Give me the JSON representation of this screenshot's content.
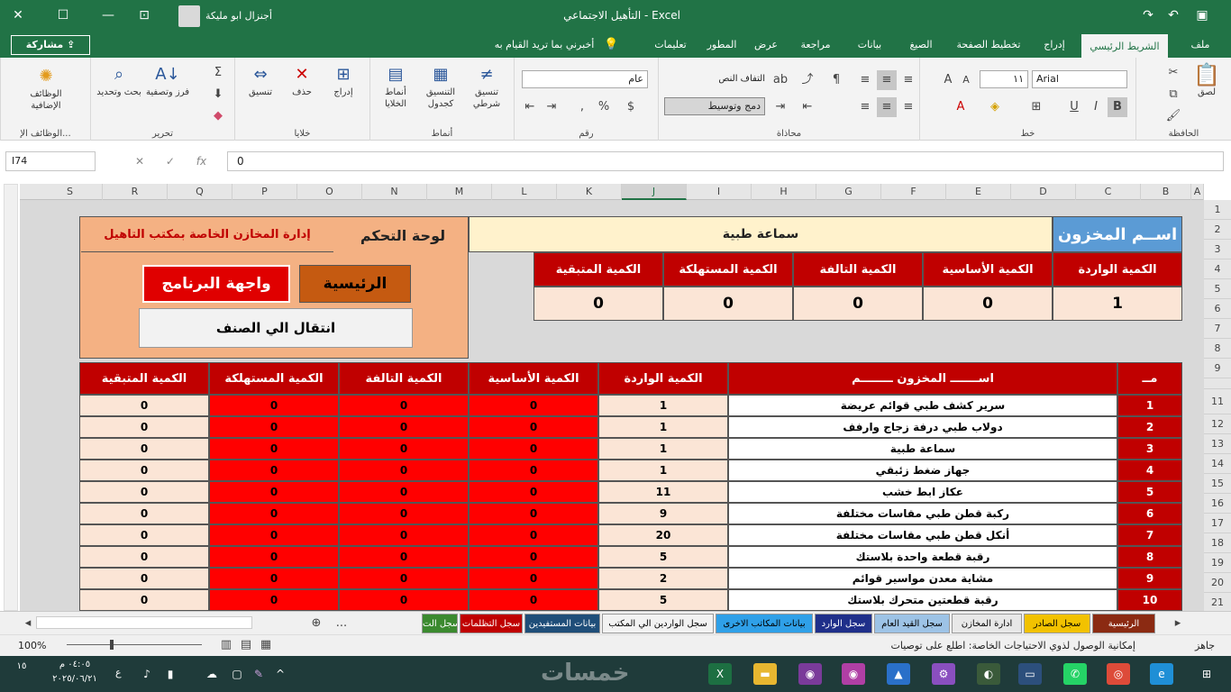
{
  "window": {
    "title": "التأهيل الاجتماعي  -  Excel",
    "user": "أجنزال ابو مليكة"
  },
  "titlebar_icons": {
    "save": "save-icon",
    "undo": "undo-icon",
    "redo": "redo-icon",
    "restore": "restore-icon",
    "minimize": "minimize-icon",
    "close": "close-icon"
  },
  "menu": {
    "share": "مشاركة",
    "tellme": "أخبرني بما تريد القيام به",
    "tabs": [
      "ملف",
      "الشريط الرئيسي",
      "إدراج",
      "تخطيط الصفحة",
      "الصيغ",
      "بيانات",
      "مراجعة",
      "عرض",
      "المطور",
      "تعليمات"
    ]
  },
  "ribbon": {
    "clipboard": {
      "label": "الحافظة",
      "paste": "لصق"
    },
    "font": {
      "label": "خط",
      "name": "Arial",
      "size": "١١",
      "bold": "B"
    },
    "alignment": {
      "label": "محاذاة",
      "wrap": "التفاف النص",
      "merge": "دمج وتوسيط"
    },
    "number": {
      "label": "رقم",
      "format": "عام"
    },
    "styles": {
      "label": "أنماط",
      "conditional": "تنسيق شرطي",
      "table": "التنسيق كجدول",
      "cell": "أنماط الخلايا"
    },
    "cells": {
      "label": "خلايا",
      "insert": "إدراج",
      "delete": "حذف",
      "format": "تنسيق"
    },
    "editing": {
      "label": "تحرير",
      "sort": "فرز وتصفية",
      "find": "بحث وتحديد"
    },
    "addins": {
      "label": "الوظائف الإ...",
      "name": "الوظائف الإضافية"
    }
  },
  "formula": {
    "namebox": "I74",
    "fx": "fx",
    "value": "0"
  },
  "columns": [
    "A",
    "B",
    "C",
    "D",
    "E",
    "F",
    "G",
    "H",
    "I",
    "J",
    "K",
    "L",
    "M",
    "N",
    "O",
    "P",
    "Q",
    "R",
    "S"
  ],
  "rows": [
    "1",
    "2",
    "3",
    "4",
    "5",
    "6",
    "7",
    "8",
    "9",
    "",
    "11",
    "12",
    "13",
    "14",
    "15",
    "16",
    "17",
    "18",
    "19",
    "20",
    "21"
  ],
  "top": {
    "store_label": "اســم المخزون",
    "store_value": "سماعة طبية",
    "control_title": "لوحة التحكم",
    "admin_title": "إدارة المخازن الخاصة بمكتب التاهيل",
    "btn_main": "الرئيسية",
    "btn_ui": "واجهة البرنامج",
    "btn_goto": "انتقال الي الصنف",
    "headers": [
      "الكمية الواردة",
      "الكمية الأساسية",
      "الكمية التالفة",
      "الكمية المستهلكة",
      "الكمية المتبقية"
    ],
    "values": [
      "1",
      "0",
      "0",
      "0",
      "0"
    ]
  },
  "table": {
    "headers": [
      "مــ",
      "اســـــــ المخزون ــــــــم",
      "الكمية الواردة",
      "الكمية الأساسية",
      "الكمية التالفة",
      "الكمية المستهلكة",
      "الكمية المتبقية"
    ],
    "rows": [
      [
        "1",
        "سرير كشف طبي قوائم عريضة",
        "1",
        "0",
        "0",
        "0",
        "0"
      ],
      [
        "2",
        "دولاب طبي درفة زجاج وارفف",
        "1",
        "0",
        "0",
        "0",
        "0"
      ],
      [
        "3",
        "سماعة طبية",
        "1",
        "0",
        "0",
        "0",
        "0"
      ],
      [
        "4",
        "جهاز ضغط زئبقي",
        "1",
        "0",
        "0",
        "0",
        "0"
      ],
      [
        "5",
        "عكاز ابط خشب",
        "11",
        "0",
        "0",
        "0",
        "0"
      ],
      [
        "6",
        "ركبة قطن طبي مقاسات مختلفة",
        "9",
        "0",
        "0",
        "0",
        "0"
      ],
      [
        "7",
        "أنكل قطن طبي مقاسات مختلفة",
        "20",
        "0",
        "0",
        "0",
        "0"
      ],
      [
        "8",
        "رقبة قطعة واحدة بلاستك",
        "5",
        "0",
        "0",
        "0",
        "0"
      ],
      [
        "9",
        "مشاية معدن مواسير قوائم",
        "2",
        "0",
        "0",
        "0",
        "0"
      ],
      [
        "10",
        "رقبة قطعتين متحرك بلاستك",
        "5",
        "0",
        "0",
        "0",
        "0"
      ]
    ]
  },
  "sheets": [
    "الرئيسية",
    "سجل الصادر",
    "ادارة المخازن",
    "سجل القيد العام",
    "سجل الوارد",
    "بيانات المكاتب الاخرى",
    "سجل الواردين الي المكتب",
    "بيانات المستفيدين",
    "سجل التظلمات",
    "سجل الت"
  ],
  "sheet_colors": [
    "#8b2a12",
    "#f2c200",
    "#e8e8e8",
    "#9dc3e6",
    "#1f2f8a",
    "#2fa0e8",
    "#f2f2f2",
    "#1f4e79",
    "#c00000",
    "#3b8a2f"
  ],
  "sheet_more": "...",
  "status": {
    "ready": "جاهز",
    "accessibility": "إمكانية الوصول لذوي الاحتياجات الخاصة: اطلع على توصيات",
    "zoom": "100%"
  },
  "taskbar": {
    "time": "٠٤:٠٥ م",
    "date": "٢٠٢٥/٠٦/٢١",
    "lang": "ع",
    "notif": "١٥",
    "watermark": "خمسات"
  }
}
